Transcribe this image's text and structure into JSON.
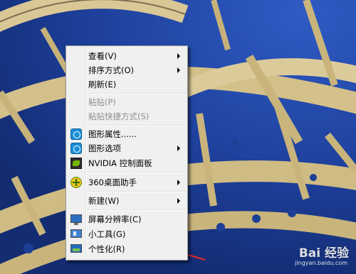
{
  "menu": {
    "items": [
      {
        "label": "查看(V)",
        "submenu": true,
        "disabled": false,
        "icon": ""
      },
      {
        "label": "排序方式(O)",
        "submenu": true,
        "disabled": false,
        "icon": ""
      },
      {
        "label": "刷新(E)",
        "submenu": false,
        "disabled": false,
        "icon": ""
      },
      {
        "label": "粘贴(P)",
        "submenu": false,
        "disabled": true,
        "icon": ""
      },
      {
        "label": "粘贴快捷方式(S)",
        "submenu": false,
        "disabled": true,
        "icon": ""
      },
      {
        "label": "图形属性......",
        "submenu": false,
        "disabled": false,
        "icon": "intel-graphics-icon"
      },
      {
        "label": "图形选项",
        "submenu": true,
        "disabled": false,
        "icon": "intel-graphics-icon"
      },
      {
        "label": "NVIDIA 控制面板",
        "submenu": false,
        "disabled": false,
        "icon": "nvidia-icon"
      },
      {
        "label": "360桌面助手",
        "submenu": true,
        "disabled": false,
        "icon": "360-icon"
      },
      {
        "label": "新建(W)",
        "submenu": true,
        "disabled": false,
        "icon": ""
      },
      {
        "label": "屏幕分辨率(C)",
        "submenu": false,
        "disabled": false,
        "icon": "display-icon"
      },
      {
        "label": "小工具(G)",
        "submenu": false,
        "disabled": false,
        "icon": "gadgets-icon"
      },
      {
        "label": "个性化(R)",
        "submenu": false,
        "disabled": false,
        "icon": "personalize-icon"
      }
    ]
  },
  "annotation": {
    "color": "#e3262b",
    "points_to": "个性化(R)"
  },
  "watermark": {
    "text": "Bai 经验",
    "sub": "jingyan.baidu.com"
  },
  "colors": {
    "desktop_sky": "#1c3f96",
    "arches": "#d8c79a",
    "menu_bg": "#f0f0f0"
  }
}
